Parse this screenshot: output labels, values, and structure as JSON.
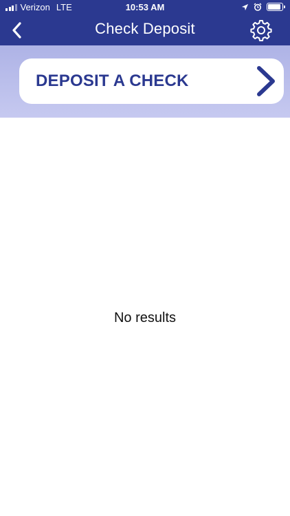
{
  "status_bar": {
    "carrier": "Verizon",
    "network": "LTE",
    "time": "10:53 AM",
    "battery_level": 0.9
  },
  "nav": {
    "title": "Check Deposit",
    "back_icon": "chevron-left-icon",
    "settings_icon": "gear-icon"
  },
  "deposit": {
    "label": "DEPOSIT A CHECK",
    "chevron_icon": "chevron-right-icon"
  },
  "results": {
    "empty_message": "No results"
  },
  "colors": {
    "brand": "#2b3990",
    "band": "#bfc3ee",
    "background": "#ffffff"
  }
}
